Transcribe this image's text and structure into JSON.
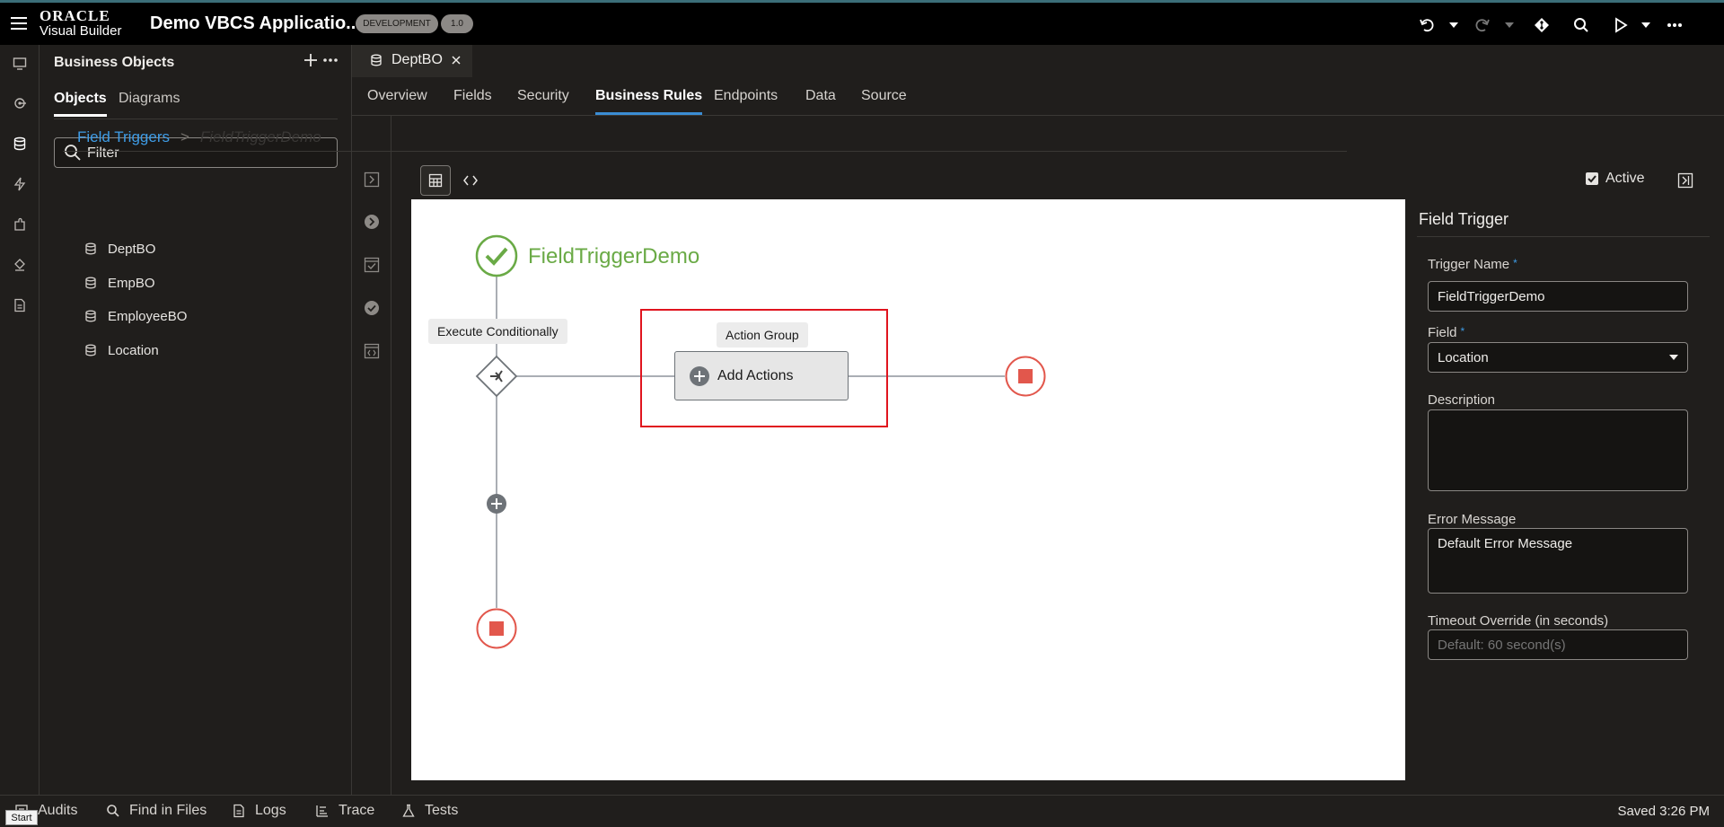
{
  "header": {
    "brand_top": "ORACLE",
    "brand_bottom": "Visual Builder",
    "app_title": "Demo VBCS Applicatio...",
    "env_badge": "DEVELOPMENT",
    "version_badge": "1.0"
  },
  "bo_panel": {
    "title": "Business Objects",
    "tabs": [
      "Objects",
      "Diagrams"
    ],
    "filter_value": "",
    "filter_placeholder": "Filter",
    "items": [
      "DeptBO",
      "EmpBO",
      "EmployeeBO",
      "Location"
    ]
  },
  "editor": {
    "file_tab": "DeptBO",
    "nav_tabs": [
      "Overview",
      "Fields",
      "Security",
      "Business Rules",
      "Endpoints",
      "Data",
      "Source"
    ],
    "breadcrumb": {
      "root": "Field Triggers",
      "separator": ">",
      "current": "FieldTriggerDemo"
    },
    "active_label": "Active"
  },
  "canvas": {
    "start_label": "FieldTriggerDemo",
    "execute_label": "Execute Conditionally",
    "action_group_label": "Action Group",
    "add_actions_label": "Add Actions"
  },
  "properties": {
    "title": "Field Trigger",
    "trigger_name_label": "Trigger Name",
    "trigger_name_value": "FieldTriggerDemo",
    "field_label": "Field",
    "field_value": "Location",
    "description_label": "Description",
    "description_value": "",
    "error_label": "Error Message",
    "error_value": "Default Error Message",
    "timeout_label": "Timeout Override (in seconds)",
    "timeout_value": "Default: 60 second(s)",
    "required_mark": "*"
  },
  "footer": {
    "items": [
      "Audits",
      "Find in Files",
      "Logs",
      "Trace",
      "Tests"
    ],
    "saved": "Saved 3:26 PM",
    "tooltip": "Start"
  },
  "colors": {
    "accent_blue": "#3e9ce6",
    "start_green": "#6aaa46",
    "end_red": "#e2574c",
    "highlight_red": "#e0141e"
  },
  "icons": [
    "menu-icon",
    "undo-icon",
    "redo-icon",
    "git-icon",
    "search-icon",
    "play-icon",
    "more-icon",
    "database-icon",
    "plus-icon",
    "close-icon"
  ]
}
